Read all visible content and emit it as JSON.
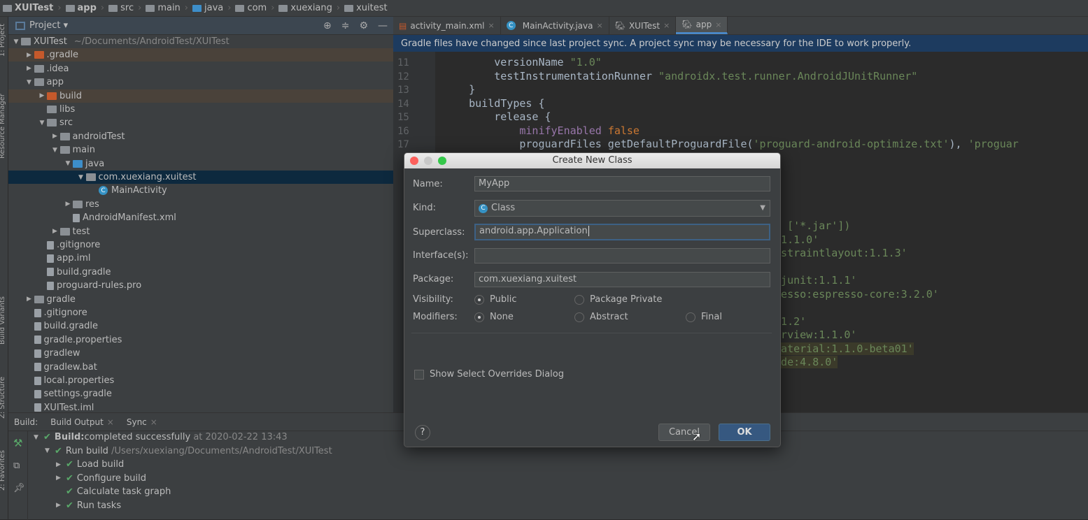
{
  "breadcrumb": [
    "XUITest",
    "app",
    "src",
    "main",
    "java",
    "com",
    "xuexiang",
    "xuitest"
  ],
  "left_strip": {
    "project": "1: Project",
    "resource_manager": "Resource Manager",
    "build_variants": "Build Variants",
    "structure": "Z: Structure",
    "favorites": "2: Favorites"
  },
  "project_panel": {
    "title": "Project",
    "tree": [
      {
        "label": "XUITest",
        "extra": "~/Documents/AndroidTest/XUITest",
        "depth": 0,
        "arrow": "down",
        "icon": "project"
      },
      {
        "label": ".gradle",
        "depth": 1,
        "arrow": "right",
        "icon": "folder-orange",
        "highlight": true
      },
      {
        "label": ".idea",
        "depth": 1,
        "arrow": "right",
        "icon": "folder"
      },
      {
        "label": "app",
        "depth": 1,
        "arrow": "down",
        "icon": "module"
      },
      {
        "label": "build",
        "depth": 2,
        "arrow": "right",
        "icon": "folder-orange",
        "highlight": true
      },
      {
        "label": "libs",
        "depth": 2,
        "arrow": "",
        "icon": "folder"
      },
      {
        "label": "src",
        "depth": 2,
        "arrow": "down",
        "icon": "folder"
      },
      {
        "label": "androidTest",
        "depth": 3,
        "arrow": "right",
        "icon": "folder"
      },
      {
        "label": "main",
        "depth": 3,
        "arrow": "down",
        "icon": "folder"
      },
      {
        "label": "java",
        "depth": 4,
        "arrow": "down",
        "icon": "folder-blue"
      },
      {
        "label": "com.xuexiang.xuitest",
        "depth": 5,
        "arrow": "down",
        "icon": "package",
        "selected": true
      },
      {
        "label": "MainActivity",
        "depth": 6,
        "arrow": "",
        "icon": "class"
      },
      {
        "label": "res",
        "depth": 4,
        "arrow": "right",
        "icon": "folder"
      },
      {
        "label": "AndroidManifest.xml",
        "depth": 4,
        "arrow": "",
        "icon": "file"
      },
      {
        "label": "test",
        "depth": 3,
        "arrow": "right",
        "icon": "folder"
      },
      {
        "label": ".gitignore",
        "depth": 2,
        "arrow": "",
        "icon": "file"
      },
      {
        "label": "app.iml",
        "depth": 2,
        "arrow": "",
        "icon": "file"
      },
      {
        "label": "build.gradle",
        "depth": 2,
        "arrow": "",
        "icon": "file"
      },
      {
        "label": "proguard-rules.pro",
        "depth": 2,
        "arrow": "",
        "icon": "file"
      },
      {
        "label": "gradle",
        "depth": 1,
        "arrow": "right",
        "icon": "folder"
      },
      {
        "label": ".gitignore",
        "depth": 1,
        "arrow": "",
        "icon": "file"
      },
      {
        "label": "build.gradle",
        "depth": 1,
        "arrow": "",
        "icon": "file"
      },
      {
        "label": "gradle.properties",
        "depth": 1,
        "arrow": "",
        "icon": "file"
      },
      {
        "label": "gradlew",
        "depth": 1,
        "arrow": "",
        "icon": "file"
      },
      {
        "label": "gradlew.bat",
        "depth": 1,
        "arrow": "",
        "icon": "file"
      },
      {
        "label": "local.properties",
        "depth": 1,
        "arrow": "",
        "icon": "file"
      },
      {
        "label": "settings.gradle",
        "depth": 1,
        "arrow": "",
        "icon": "file"
      },
      {
        "label": "XUITest.iml",
        "depth": 1,
        "arrow": "",
        "icon": "file"
      }
    ]
  },
  "editor_tabs": [
    {
      "label": "activity_main.xml",
      "icon": "xml-icon"
    },
    {
      "label": "MainActivity.java",
      "icon": "class-icon"
    },
    {
      "label": "XUITest",
      "icon": "gradle-icon"
    },
    {
      "label": "app",
      "icon": "gradle-icon",
      "active": true
    }
  ],
  "banner": "Gradle files have changed since last project sync. A project sync may be necessary for the IDE to work properly.",
  "code": {
    "lines": [
      {
        "n": "11",
        "parts": [
          [
            "        versionName ",
            ""
          ],
          [
            "\"1.0\"",
            "str"
          ]
        ]
      },
      {
        "n": "12",
        "parts": [
          [
            "        testInstrumentationRunner ",
            ""
          ],
          [
            "\"androidx.test.runner.AndroidJUnitRunner\"",
            "str"
          ]
        ]
      },
      {
        "n": "13",
        "parts": [
          [
            "    }",
            ""
          ]
        ]
      },
      {
        "n": "14",
        "parts": [
          [
            "    buildTypes {",
            ""
          ]
        ]
      },
      {
        "n": "15",
        "parts": [
          [
            "        release {",
            ""
          ]
        ]
      },
      {
        "n": "16",
        "parts": [
          [
            "            ",
            ""
          ],
          [
            "minifyEnabled ",
            "pr"
          ],
          [
            "false",
            "kw"
          ]
        ]
      },
      {
        "n": "17",
        "parts": [
          [
            "            proguardFiles getDefaultProguardFile(",
            ""
          ],
          [
            "'proguard-android-optimize.txt'",
            "str"
          ],
          [
            "), ",
            ""
          ],
          [
            "'proguar",
            "str"
          ]
        ]
      }
    ],
    "fragments": [
      {
        "text": "e: ['*.jar'])",
        "row": 0
      },
      {
        "text": "t:1.1.0'",
        "row": 1
      },
      {
        "text": "onstraintlayout:1.1.3'",
        "row": 2
      },
      {
        "text": "t:junit:1.1.1'",
        "row": 4
      },
      {
        "text": "oresso:espresso-core:3.2.0'",
        "row": 5
      },
      {
        "text": "1.1.2'",
        "row": 7
      },
      {
        "text": "lerview:1.1.0'",
        "row": 8
      },
      {
        "text": ":material:1.1.0-beta01'",
        "row": 9,
        "marked": true
      },
      {
        "text": "lide:4.8.0'",
        "row": 10,
        "marked": true
      }
    ]
  },
  "build": {
    "label": "Build:",
    "tabs": [
      "Build Output",
      "Sync"
    ],
    "items": [
      {
        "bold": "Build:",
        "text": " completed successfully",
        "dim": " at 2020-02-22 13:43",
        "depth": 0,
        "arrow": "down"
      },
      {
        "text": "Run build",
        "dim": " /Users/xuexiang/Documents/AndroidTest/XUITest",
        "depth": 1,
        "arrow": "down"
      },
      {
        "text": "Load build",
        "depth": 2,
        "arrow": "right"
      },
      {
        "text": "Configure build",
        "depth": 2,
        "arrow": "right"
      },
      {
        "text": "Calculate task graph",
        "depth": 2,
        "arrow": ""
      },
      {
        "text": "Run tasks",
        "depth": 2,
        "arrow": "right"
      }
    ]
  },
  "dialog": {
    "title": "Create New Class",
    "name_label": "Name:",
    "name_value": "MyApp",
    "kind_label": "Kind:",
    "kind_value": "Class",
    "superclass_label": "Superclass:",
    "superclass_value": "android.app.Application",
    "interfaces_label": "Interface(s):",
    "interfaces_value": "",
    "package_label": "Package:",
    "package_value": "com.xuexiang.xuitest",
    "visibility_label": "Visibility:",
    "visibility_options": [
      "Public",
      "Package Private"
    ],
    "visibility_selected": "Public",
    "modifiers_label": "Modifiers:",
    "modifiers_options": [
      "None",
      "Abstract",
      "Final"
    ],
    "modifiers_selected": "None",
    "overrides_label": "Show Select Overrides Dialog",
    "overrides_checked": false,
    "help": "?",
    "cancel": "Cancel",
    "ok": "OK"
  },
  "colors": {
    "accent": "#4a88c7",
    "selection": "#0d293e",
    "success": "#59a869",
    "banner": "#1d3b5f",
    "ok_button": "#365880"
  }
}
